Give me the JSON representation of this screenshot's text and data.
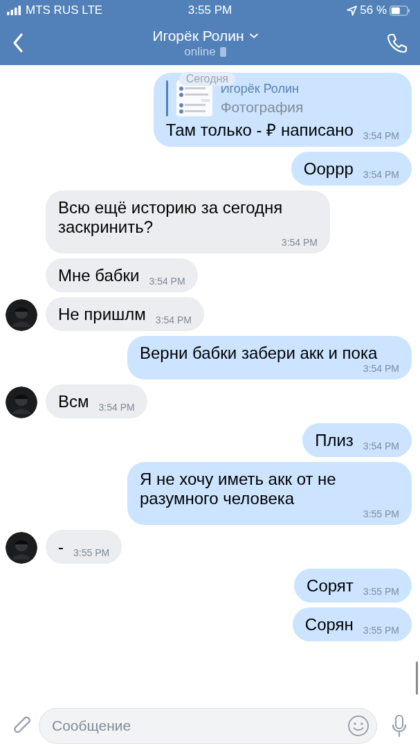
{
  "status_bar": {
    "carrier": "MTS RUS LTE",
    "time": "3:55 PM",
    "battery": "56 %"
  },
  "header": {
    "title": "Игорёк Ролин",
    "subtitle": "online"
  },
  "date_badge": "Сегодня",
  "messages": [
    {
      "outgoing": true,
      "avatar": false,
      "reply": {
        "author": "Игорёк Ролин",
        "kind": "Фотография"
      },
      "text": "Там только - ₽ написано",
      "time": "3:54 PM"
    },
    {
      "outgoing": true,
      "avatar": false,
      "text": "Ооррр",
      "time": "3:54 PM"
    },
    {
      "outgoing": false,
      "avatar": false,
      "text": "Всю ещё историю за сегодня заскринить?",
      "time": "3:54 PM"
    },
    {
      "outgoing": false,
      "avatar": false,
      "text": "Мне бабки",
      "time": "3:54 PM"
    },
    {
      "outgoing": false,
      "avatar": true,
      "text": "Не пришлм",
      "time": "3:54 PM"
    },
    {
      "outgoing": true,
      "avatar": false,
      "text": "Верни бабки забери акк и пока",
      "time": "3:54 PM"
    },
    {
      "outgoing": false,
      "avatar": true,
      "text": "Всм",
      "time": "3:54 PM"
    },
    {
      "outgoing": true,
      "avatar": false,
      "text": "Плиз",
      "time": "3:54 PM"
    },
    {
      "outgoing": true,
      "avatar": false,
      "text": "Я не хочу иметь акк от не разумного человека",
      "time": "3:55 PM"
    },
    {
      "outgoing": false,
      "avatar": true,
      "text": "-",
      "time": "3:55 PM"
    },
    {
      "outgoing": true,
      "avatar": false,
      "text": "Сорят",
      "time": "3:55 PM"
    },
    {
      "outgoing": true,
      "avatar": false,
      "text": "Сорян",
      "time": "3:55 PM"
    }
  ],
  "composer": {
    "placeholder": "Сообщение"
  }
}
